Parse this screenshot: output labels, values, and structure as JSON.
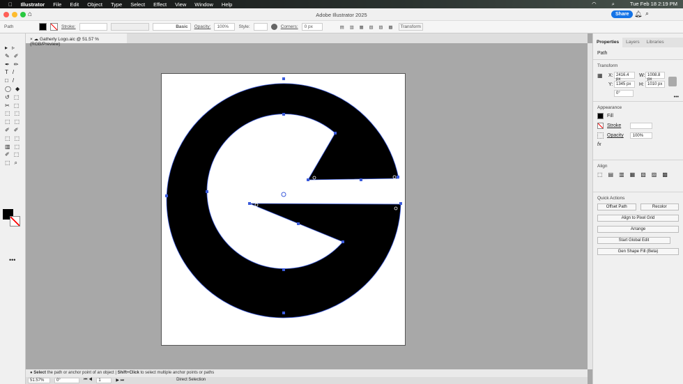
{
  "menubar": {
    "app": "Illustrator",
    "items": [
      "File",
      "Edit",
      "Object",
      "Type",
      "Select",
      "Effect",
      "View",
      "Window",
      "Help"
    ],
    "datetime": "Tue Feb 18  2:19 PM"
  },
  "window": {
    "title": "Adobe Illustrator 2025",
    "share": "Share"
  },
  "control": {
    "selection": "Path",
    "stroke_label": "Stroke:",
    "brush": "Basic",
    "opacity_label": "Opacity:",
    "opacity": "100%",
    "style_label": "Style:",
    "corners_label": "Corners:",
    "corners": "0 px",
    "transform": "Transform"
  },
  "document": {
    "tab": "Gatherly Logo.aic @ 51.57 % (RGB/Preview)"
  },
  "panel": {
    "tabs": [
      "Properties",
      "Layers",
      "Libraries"
    ],
    "kind": "Path",
    "transform": {
      "title": "Transform",
      "x_label": "X:",
      "x": "2416.4 px",
      "y_label": "Y:",
      "y": "1345 px",
      "w_label": "W:",
      "w": "1008.8 px",
      "h_label": "H:",
      "h": "1010 px",
      "angle": "0°"
    },
    "appearance": {
      "title": "Appearance",
      "fill": "Fill",
      "stroke": "Stroke",
      "opacity_label": "Opacity",
      "opacity": "100%"
    },
    "align": {
      "title": "Align"
    },
    "quick": {
      "title": "Quick Actions",
      "offset": "Offset Path",
      "recolor": "Recolor",
      "pixel": "Align to Pixel Grid",
      "arrange": "Arrange",
      "global": "Start Global Edit",
      "gen": "Gen Shape Fill (Beta)"
    }
  },
  "status": {
    "b1": "Select",
    "t1": " the path or anchor point of an object  |  ",
    "b2": "Shift+Click",
    "t2": " to select multiple anchor points or paths",
    "zoom": "51.57%",
    "angle": "0°",
    "artboard": "1",
    "tool": "Direct Selection"
  },
  "colors": {
    "accent": "#1473e6",
    "selection": "#3b5bdb"
  }
}
